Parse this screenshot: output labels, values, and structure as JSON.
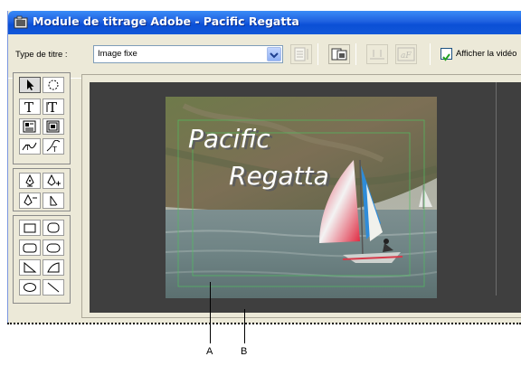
{
  "window": {
    "title": "Module de titrage Adobe - Pacific Regatta",
    "titlebar_color": "#0a4fd6"
  },
  "toolbar": {
    "type_label": "Type de titre :",
    "type_value": "Image fixe",
    "show_video_label": "Afficher la vidéo",
    "show_video_checked": true,
    "buttons": [
      "roll-crawl-options-icon",
      "templates-icon",
      "tab-stops-icon",
      "styles-icon"
    ]
  },
  "palette": {
    "tools": [
      "selection-tool-icon",
      "rotation-tool-icon",
      "type-tool-icon",
      "vertical-type-tool-icon",
      "area-type-tool-icon",
      "vertical-area-type-tool-icon",
      "path-type-tool-icon",
      "vertical-path-type-tool-icon",
      "pen-tool-icon",
      "add-anchor-point-tool-icon",
      "delete-anchor-point-tool-icon",
      "convert-anchor-point-tool-icon",
      "rectangle-tool-icon",
      "rounded-corner-rectangle-tool-icon",
      "clipped-corner-rectangle-tool-icon",
      "rounded-rectangle-tool-icon",
      "wedge-tool-icon",
      "arc-tool-icon",
      "ellipse-tool-icon",
      "line-tool-icon"
    ]
  },
  "canvas": {
    "title_line1": "Pacific",
    "title_line2": "Regatta"
  },
  "callouts": {
    "a": "A",
    "b": "B"
  }
}
